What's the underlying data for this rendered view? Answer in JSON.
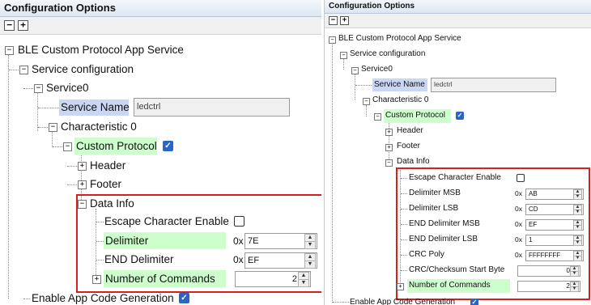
{
  "left_panel": {
    "title": "Configuration Options",
    "toolbar": {
      "collapse": "−",
      "expand": "+"
    },
    "tree": {
      "root": "BLE Custom Protocol App Service",
      "service_configuration": "Service configuration",
      "service0": "Service0",
      "service_name_label": "Service Name",
      "service_name_value": "ledctrl",
      "characteristic0": "Characteristic 0",
      "custom_protocol": "Custom Protocol",
      "custom_protocol_checked": true,
      "header": "Header",
      "footer": "Footer",
      "data_info": "Data Info",
      "escape_label": "Escape Character Enable",
      "escape_checked": false,
      "delimiter_label": "Delimiter",
      "delimiter_prefix": "0x",
      "delimiter_value": "7E",
      "end_delimiter_label": "END Delimiter",
      "end_delimiter_prefix": "0x",
      "end_delimiter_value": "EF",
      "num_commands_label": "Number of Commands",
      "num_commands_value": "2",
      "enable_app_code": "Enable App Code Generation",
      "enable_app_code_checked": true
    }
  },
  "right_panel": {
    "title": "Configuration Options",
    "toolbar": {
      "collapse": "−",
      "expand": "+"
    },
    "tree": {
      "root": "BLE Custom Protocol App Service",
      "service_configuration": "Service configuration",
      "service0": "Service0",
      "service_name_label": "Service Name",
      "service_name_value": "ledctrl",
      "characteristic0": "Characteristic 0",
      "custom_protocol": "Custom Protocol",
      "custom_protocol_checked": true,
      "header": "Header",
      "footer": "Footer",
      "data_info": "Data Info",
      "escape_label": "Escape Character Enable",
      "escape_checked": false,
      "prefix": "0x",
      "delimiter_msb_label": "Delimiter MSB",
      "delimiter_msb_value": "AB",
      "delimiter_lsb_label": "Delimiter LSB",
      "delimiter_lsb_value": "CD",
      "end_delimiter_msb_label": "END Delimiter MSB",
      "end_delimiter_msb_value": "EF",
      "end_delimiter_lsb_label": "END Delimiter LSB",
      "end_delimiter_lsb_value": "1",
      "crc_poly_label": "CRC Poly",
      "crc_poly_value": "FFFFFFFF",
      "crc_start_label": "CRC/Checksum Start Byte",
      "crc_start_value": "0",
      "num_commands_label": "Number of Commands",
      "num_commands_value": "2",
      "enable_app_code": "Enable App Code Generation"
    }
  },
  "colors": {
    "highlight": "#ccffcc",
    "selected": "#c9d7f2",
    "annotation_box": "#d81f1f",
    "checkbox_checked": "#2a64c5"
  },
  "icons": {
    "expand": "plus-box-icon",
    "collapse": "minus-box-icon",
    "check": "checkmark-icon"
  }
}
